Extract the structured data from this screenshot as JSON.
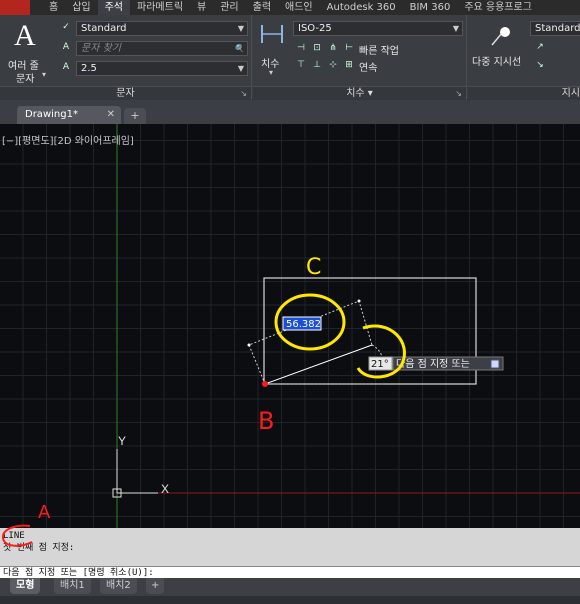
{
  "ribbon_tabs": [
    "홈",
    "삽입",
    "주석",
    "파라메트릭",
    "뷰",
    "관리",
    "출력",
    "애드인",
    "Autodesk 360",
    "BIM 360",
    "주요 응용프로그"
  ],
  "active_tab_index": 2,
  "text_panel": {
    "big_button_label_1": "여러 줄",
    "big_button_label_2": "문자",
    "style": "Standard",
    "find_placeholder": "문자 찾기",
    "height": "2.5",
    "title": "문자"
  },
  "dim_panel": {
    "big_button_label": "치수",
    "style": "ISO-25",
    "quick": "빠른 작업",
    "continue": "연속",
    "title": "치수"
  },
  "leader_panel": {
    "button_label": "다중 지시선",
    "style": "Standard",
    "title": "지시"
  },
  "document_tab": "Drawing1*",
  "viewport_label": "[−][평면도][2D 와이어프레임]",
  "drawing": {
    "length_input": "56.382",
    "angle_input": "21°",
    "tooltip": "다음 점 지정 또는",
    "annotations": {
      "a": "A",
      "b": "B",
      "c": "C"
    },
    "ucs_y": "Y",
    "ucs_x": "X"
  },
  "command": {
    "history": [
      "LINE",
      "첫 번째 점 지정:"
    ],
    "prompt": "다음 점 지정 또는 [명령 취소(U)]:"
  },
  "layout_tabs": [
    "모형",
    "배치1",
    "배치2"
  ],
  "active_layout_index": 0,
  "colors": {
    "highlight": "#ffe800",
    "annotation_red": "#ff1a1a",
    "x_axis": "#8b1a1a",
    "y_axis": "#2f7a2f"
  }
}
